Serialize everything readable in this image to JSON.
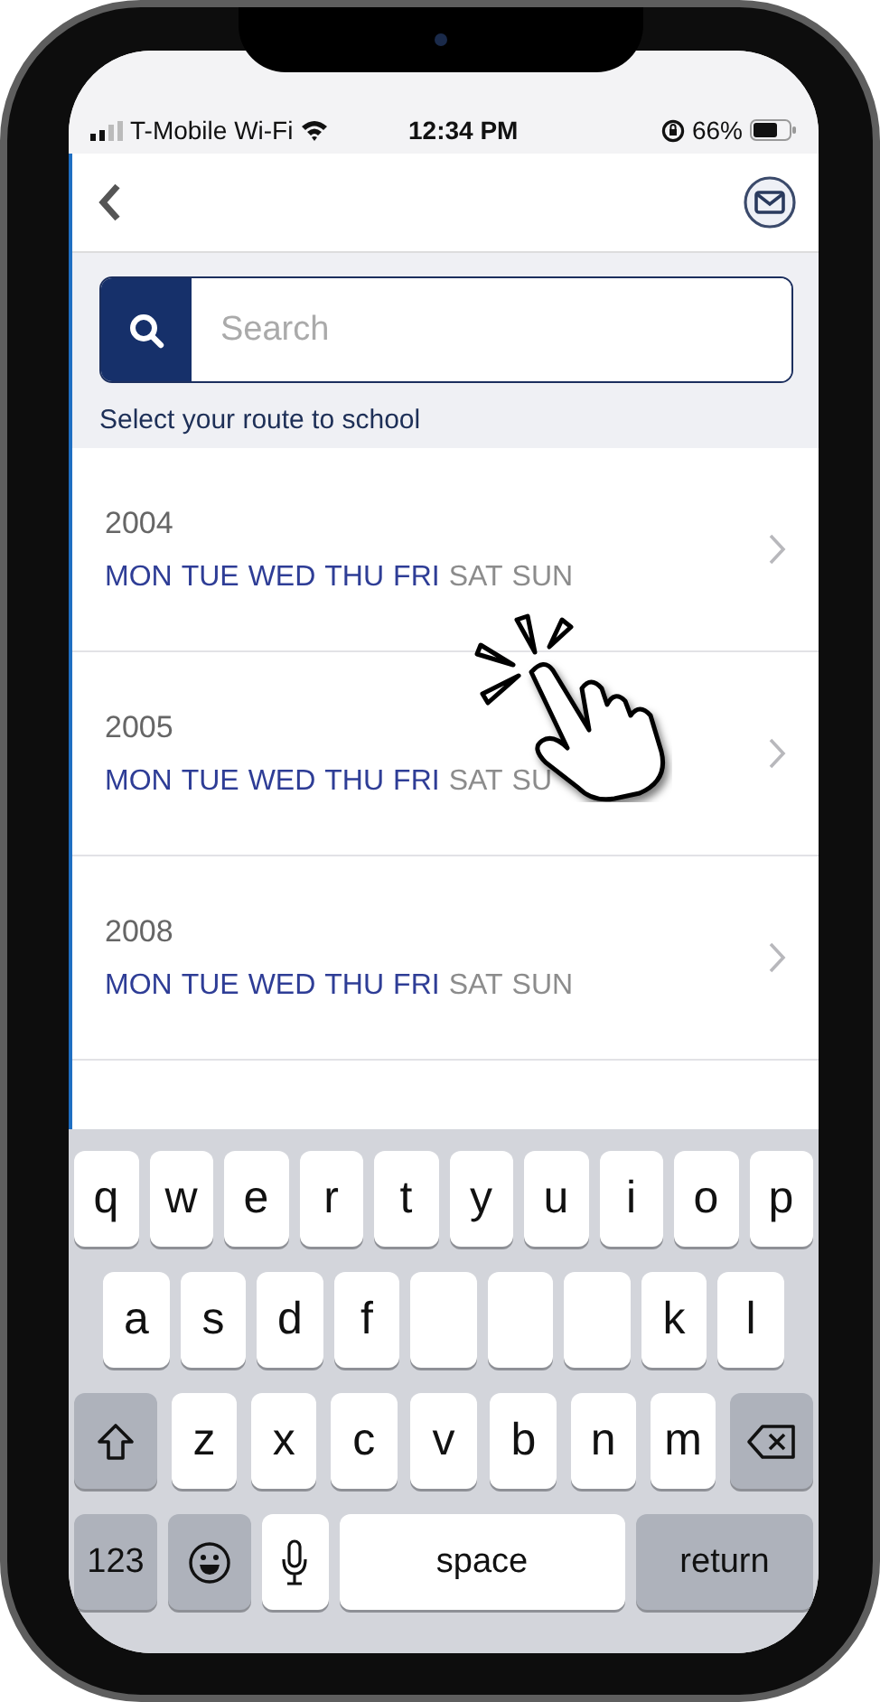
{
  "status_bar": {
    "carrier": "T-Mobile Wi-Fi",
    "time": "12:34 PM",
    "battery": "66%"
  },
  "search": {
    "placeholder": "Search"
  },
  "section_label": "Select your route to school",
  "routes": [
    {
      "number": "2004",
      "days": [
        {
          "label": "MON",
          "active": true
        },
        {
          "label": "TUE",
          "active": true
        },
        {
          "label": "WED",
          "active": true
        },
        {
          "label": "THU",
          "active": true
        },
        {
          "label": "FRI",
          "active": true
        },
        {
          "label": "SAT",
          "active": false
        },
        {
          "label": "SUN",
          "active": false
        }
      ]
    },
    {
      "number": "2005",
      "days": [
        {
          "label": "MON",
          "active": true
        },
        {
          "label": "TUE",
          "active": true
        },
        {
          "label": "WED",
          "active": true
        },
        {
          "label": "THU",
          "active": true
        },
        {
          "label": "FRI",
          "active": true
        },
        {
          "label": "SAT",
          "active": false
        },
        {
          "label": "SU",
          "active": false
        }
      ]
    },
    {
      "number": "2008",
      "days": [
        {
          "label": "MON",
          "active": true
        },
        {
          "label": "TUE",
          "active": true
        },
        {
          "label": "WED",
          "active": true
        },
        {
          "label": "THU",
          "active": true
        },
        {
          "label": "FRI",
          "active": true
        },
        {
          "label": "SAT",
          "active": false
        },
        {
          "label": "SUN",
          "active": false
        }
      ]
    }
  ],
  "keyboard": [
    [
      {
        "kind": "letter",
        "label": "q"
      },
      {
        "kind": "letter",
        "label": "w"
      },
      {
        "kind": "letter",
        "label": "e"
      },
      {
        "kind": "letter",
        "label": "r"
      },
      {
        "kind": "letter",
        "label": "t"
      },
      {
        "kind": "letter",
        "label": "y"
      },
      {
        "kind": "letter",
        "label": "u"
      },
      {
        "kind": "letter",
        "label": "i"
      },
      {
        "kind": "letter",
        "label": "o"
      },
      {
        "kind": "letter",
        "label": "p"
      }
    ],
    [
      {
        "kind": "letter",
        "label": "a"
      },
      {
        "kind": "letter",
        "label": "s"
      },
      {
        "kind": "letter",
        "label": "d"
      },
      {
        "kind": "letter",
        "label": "f"
      },
      {
        "kind": "covered"
      },
      {
        "kind": "covered"
      },
      {
        "kind": "covered"
      },
      {
        "kind": "letter",
        "label": "k"
      },
      {
        "kind": "letter",
        "label": "l"
      }
    ],
    [
      {
        "kind": "shift"
      },
      {
        "kind": "letter",
        "label": "z"
      },
      {
        "kind": "letter",
        "label": "x"
      },
      {
        "kind": "letter",
        "label": "c"
      },
      {
        "kind": "letter",
        "label": "v"
      },
      {
        "kind": "letter",
        "label": "b"
      },
      {
        "kind": "letter",
        "label": "n"
      },
      {
        "kind": "letter",
        "label": "m"
      },
      {
        "kind": "delete"
      }
    ],
    [
      {
        "kind": "mode",
        "label": "123"
      },
      {
        "kind": "emoji"
      },
      {
        "kind": "mic"
      },
      {
        "kind": "space",
        "label": "space"
      },
      {
        "kind": "return",
        "label": "return"
      }
    ]
  ]
}
